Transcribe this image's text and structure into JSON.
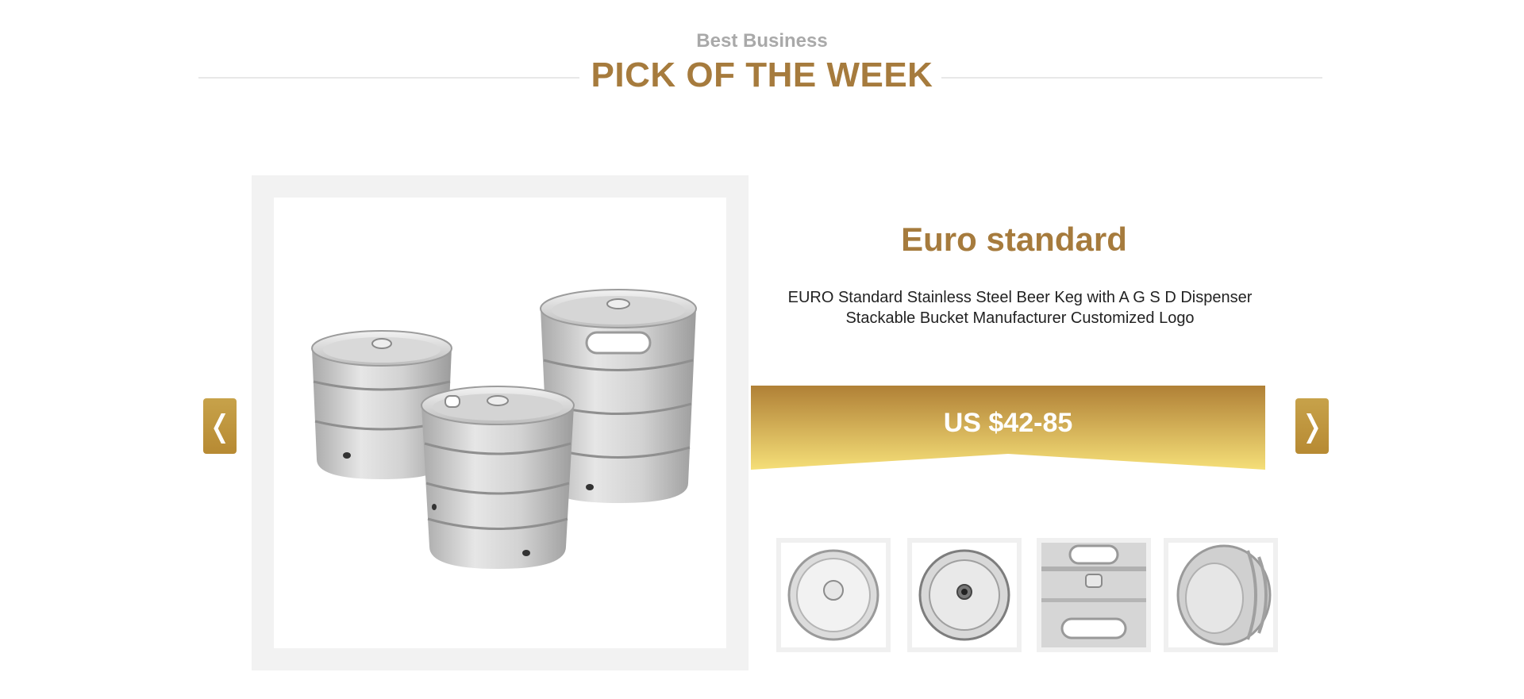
{
  "header": {
    "subtitle": "Best Business",
    "title": "PICK OF THE WEEK"
  },
  "carousel": {
    "prev_icon": "chevron-left-icon",
    "next_icon": "chevron-right-icon",
    "prev_glyph": "❬",
    "next_glyph": "❭"
  },
  "product": {
    "name": "Euro standard",
    "description": "EURO Standard Stainless Steel Beer Keg with A G S D Dispenser Stackable Bucket Manufacturer Customized Logo",
    "price": "US $42-85",
    "main_image": "beer-kegs-image",
    "thumbnails": [
      {
        "name": "keg-top-view-thumbnail"
      },
      {
        "name": "keg-bottom-view-thumbnail"
      },
      {
        "name": "keg-handle-closeup-thumbnail"
      },
      {
        "name": "keg-side-closeup-thumbnail"
      }
    ]
  },
  "colors": {
    "accent": "#a67b3d",
    "gold_dark": "#b08036",
    "gold_light": "#f3dc74",
    "subtitle_gray": "#a9a9a9"
  }
}
